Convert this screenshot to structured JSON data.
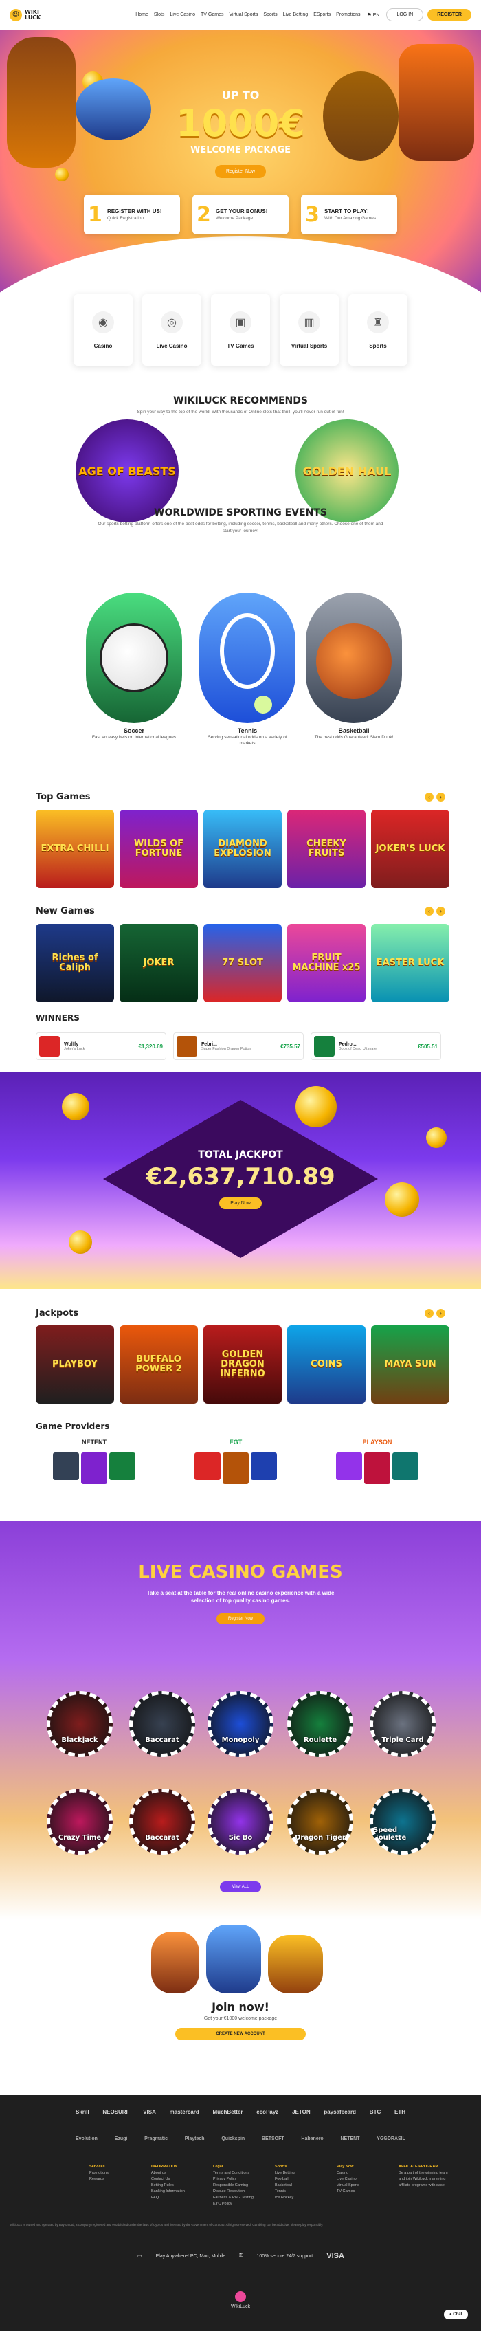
{
  "header": {
    "logo_line1": "WIKI",
    "logo_line2": "LUCK",
    "nav": [
      "Home",
      "Slots",
      "Live Casino",
      "TV Games",
      "Virtual Sports",
      "Sports",
      "Live Betting",
      "ESports",
      "Promotions"
    ],
    "lang": "EN",
    "login": "LOG IN",
    "register": "REGISTER"
  },
  "hero": {
    "upto": "UP TO",
    "amount": "1000€",
    "package": "WELCOME PACKAGE",
    "button": "Register Now"
  },
  "steps": [
    {
      "num": "1",
      "title": "REGISTER WITH US!",
      "sub": "Quick Registration"
    },
    {
      "num": "2",
      "title": "GET YOUR BONUS!",
      "sub": "Welcome Package"
    },
    {
      "num": "3",
      "title": "START TO PLAY!",
      "sub": "With Our Amazing Games"
    }
  ],
  "categories": [
    {
      "label": "Casino",
      "icon": "casino-chip-icon",
      "glyph": "◉"
    },
    {
      "label": "Live Casino",
      "icon": "roulette-icon",
      "glyph": "◎"
    },
    {
      "label": "TV Games",
      "icon": "tv-icon",
      "glyph": "▣"
    },
    {
      "label": "Virtual Sports",
      "icon": "virtual-icon",
      "glyph": "▥"
    },
    {
      "label": "Sports",
      "icon": "trophy-icon",
      "glyph": "♜"
    }
  ],
  "recommends": {
    "title": "WIKILUCK RECOMMENDS",
    "sub": "Spin your way to the top of the world: With thousands of Online slots that thrill, you'll never run out of fun!",
    "games": [
      "AGE OF BEASTS",
      "GOLDEN HAUL"
    ]
  },
  "sporting": {
    "title": "WORLDWIDE SPORTING EVENTS",
    "sub": "Our sports betting platform offers one of the best odds for betting, including soccer, tennis, basketball and many others. Choose one of them and start your journey!",
    "items": [
      {
        "name": "Soccer",
        "desc": "Fast an easy bets on international leagues"
      },
      {
        "name": "Tennis",
        "desc": "Serving sensational odds on a variety of markets"
      },
      {
        "name": "Basketball",
        "desc": "The best odds Guaranteed: Slam Dunk!"
      }
    ]
  },
  "top_games": {
    "title": "Top Games",
    "games": [
      "EXTRA CHILLI",
      "WILDS OF FORTUNE",
      "DIAMOND EXPLOSION",
      "CHEEKY FRUITS",
      "JOKER'S LUCK"
    ]
  },
  "new_games": {
    "title": "New Games",
    "games": [
      "Riches of Caliph",
      "JOKER",
      "77 SLOT",
      "FRUIT MACHINE x25",
      "EASTER LUCK"
    ]
  },
  "winners": {
    "title": "WINNERS",
    "items": [
      {
        "name": "Wolffy",
        "game": "Joker's Luck",
        "amount": "€1,320.69"
      },
      {
        "name": "Febri...",
        "game": "Super Fashion Dragon Potion",
        "amount": "€735.57"
      },
      {
        "name": "Pedro...",
        "game": "Book of Dead Ultimate",
        "amount": "€505.51"
      }
    ]
  },
  "jackpot": {
    "title": "TOTAL JACKPOT",
    "amount": "€2,637,710.89",
    "button": "Play Now"
  },
  "jackpots": {
    "title": "Jackpots",
    "games": [
      "PLAYBOY",
      "BUFFALO POWER 2",
      "GOLDEN DRAGON INFERNO",
      "COINS",
      "MAYA SUN"
    ]
  },
  "providers": {
    "title": "Game Providers",
    "items": [
      "NETENT",
      "EGT",
      "PLAYSON"
    ]
  },
  "live": {
    "title": "LIVE CASINO GAMES",
    "sub": "Take a seat at the table for the real online casino experience with a wide selection of top quality casino games.",
    "button": "Register Now",
    "chips_top": [
      "Blackjack",
      "Baccarat",
      "Monopoly",
      "Roulette",
      "Triple Card"
    ],
    "chips_bottom": [
      "Crazy Time",
      "Baccarat",
      "Sic Bo",
      "Dragon Tiger",
      "Speed Roulette"
    ],
    "view_all": "View ALL"
  },
  "join": {
    "title": "Join now!",
    "sub": "Get your €1000 welcome package",
    "button": "CREATE NEW ACCOUNT"
  },
  "footer": {
    "pay_row1": [
      "Skrill",
      "NEOSURF",
      "VISA",
      "mastercard",
      "MuchBetter",
      "ecoPayz",
      "JETON",
      "paysafecard",
      "BTC",
      "ETH"
    ],
    "pay_row2": [
      "Evolution",
      "Ezugi",
      "Pragmatic",
      "Playtech",
      "Quickspin",
      "BETSOFT",
      "Habanero",
      "NETENT",
      "YGGDRASIL"
    ],
    "cols": [
      {
        "head": "Services",
        "items": [
          "Promotions",
          "Rewards"
        ]
      },
      {
        "head": "INFORMATION",
        "items": [
          "About us",
          "Contact Us",
          "Betting Rules",
          "Banking Information",
          "FAQ"
        ]
      },
      {
        "head": "Legal",
        "items": [
          "Terms and Conditions",
          "Privacy Policy",
          "Responsible Gaming",
          "Dispute Resolution",
          "Fairness & RNG Testing",
          "KYC Policy"
        ]
      },
      {
        "head": "Sports",
        "items": [
          "Live Betting",
          "Football",
          "Basketball",
          "Tennis",
          "Ice Hockey"
        ]
      },
      {
        "head": "Play Now",
        "items": [
          "Casino",
          "Live Casino",
          "Virtual Sports",
          "TV Games"
        ]
      },
      {
        "head": "AFFILIATE PROGRAM",
        "items": [
          "Be a part of the winning team and join WikiLuck marketing affiliate programs with ease"
        ]
      }
    ],
    "note": "WikiLuck is owned and operated by Bayton Ltd, a company registered and established under the laws of Cyprus and licensed by the Government of Curacao. All rights reserved. Gambling can be addictive, please play responsibly.",
    "bar": [
      "Play Anywhere! PC, Mac, Mobile",
      "100% secure 24/7 support",
      "VISA"
    ],
    "brand": "WikiLuck",
    "chat": "Chat"
  }
}
